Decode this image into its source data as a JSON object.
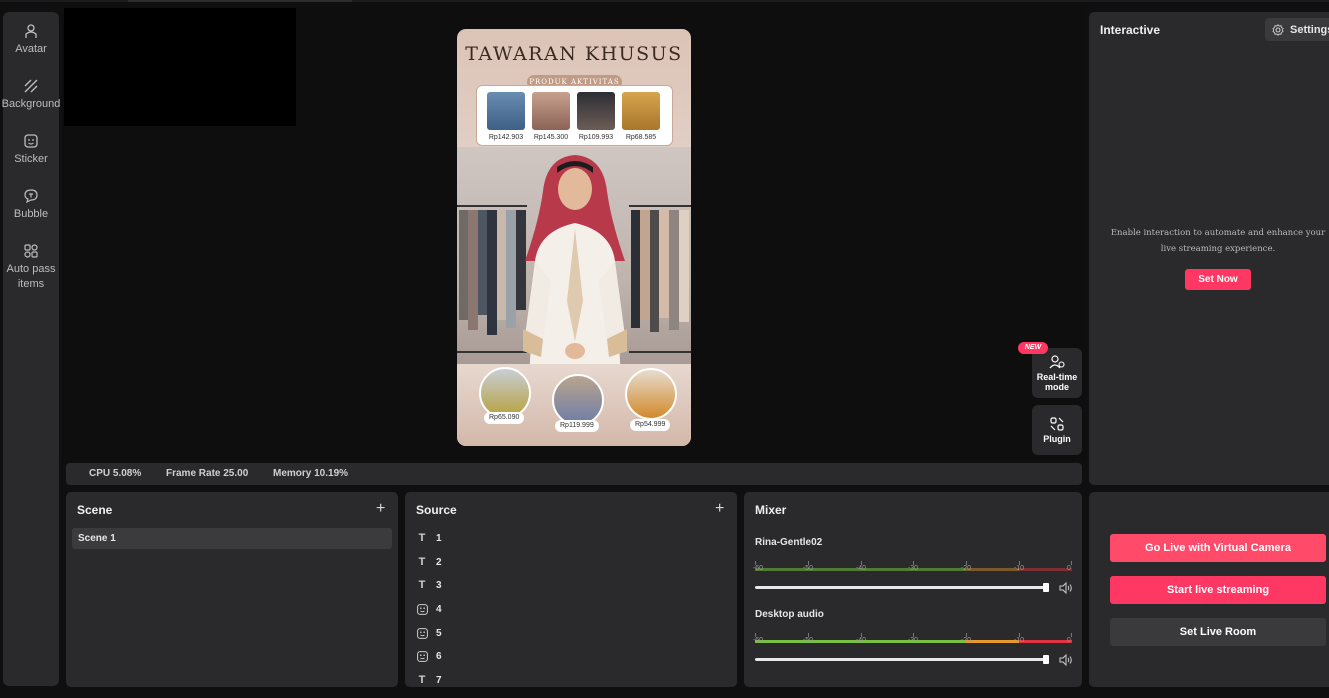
{
  "sidebar": {
    "items": [
      {
        "label": "Avatar",
        "icon": "avatar-icon"
      },
      {
        "label": "Background",
        "icon": "background-icon"
      },
      {
        "label": "Sticker",
        "icon": "sticker-icon"
      },
      {
        "label": "Bubble",
        "icon": "bubble-icon"
      },
      {
        "label": "Auto pass items",
        "icon": "auto-pass-icon"
      }
    ]
  },
  "preview": {
    "banner_title": "TAWARAN KHUSUS",
    "banner_subtitle": "PRODUK AKTIVITAS",
    "products": [
      {
        "price": "Rp142.903"
      },
      {
        "price": "Rp145.300"
      },
      {
        "price": "Rp109.993"
      },
      {
        "price": "Rp68.585"
      }
    ],
    "featured": [
      {
        "price": "Rp65.090"
      },
      {
        "price": "Rp119.999"
      },
      {
        "price": "Rp54.999"
      }
    ]
  },
  "floating": {
    "new_badge": "NEW",
    "realtime_label": "Real-time mode",
    "plugin_label": "Plugin"
  },
  "status": {
    "cpu": "CPU 5.08%",
    "frame_rate": "Frame Rate 25.00",
    "memory": "Memory 10.19%"
  },
  "scene_panel": {
    "title": "Scene",
    "add": "+",
    "items": [
      "Scene 1"
    ]
  },
  "source_panel": {
    "title": "Source",
    "add": "+",
    "items": [
      {
        "label": "1",
        "type": "text"
      },
      {
        "label": "2",
        "type": "text"
      },
      {
        "label": "3",
        "type": "text"
      },
      {
        "label": "4",
        "type": "image"
      },
      {
        "label": "5",
        "type": "image"
      },
      {
        "label": "6",
        "type": "image"
      },
      {
        "label": "7",
        "type": "text"
      }
    ]
  },
  "mixer": {
    "title": "Mixer",
    "ticks": [
      "-60",
      "-50",
      "-40",
      "-30",
      "-20",
      "-10",
      "0"
    ],
    "channels": [
      {
        "name": "Rina-Gentle02",
        "level": 1.0
      },
      {
        "name": "Desktop audio",
        "level": 1.0
      }
    ]
  },
  "interactive": {
    "title": "Interactive",
    "settings_label": "Settings",
    "hint": "Enable interaction to automate and enhance your live streaming experience.",
    "set_now": "Set Now"
  },
  "live": {
    "virtual_camera": "Go Live with Virtual Camera",
    "start_streaming": "Start live streaming",
    "set_room": "Set Live Room"
  },
  "colors": {
    "accent": "#ff3763",
    "panel": "#2a2a2d",
    "background": "#0f0f10"
  }
}
